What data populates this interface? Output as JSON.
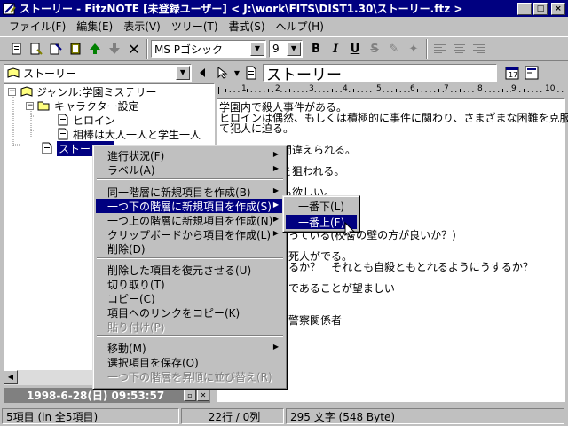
{
  "window": {
    "title": "ストーリー - FitzNOTE [未登録ユーザー] < J:\\work\\FITS\\DIST1.30\\ストーリー.ftz >",
    "minimize": "_",
    "maximize": "□",
    "close": "×"
  },
  "menubar": {
    "items": [
      {
        "label": "ファイル(F)"
      },
      {
        "label": "編集(E)"
      },
      {
        "label": "表示(V)"
      },
      {
        "label": "ツリー(T)"
      },
      {
        "label": "書式(S)"
      },
      {
        "label": "ヘルプ(H)"
      }
    ]
  },
  "toolbar": {
    "font_name": "MS Pゴシック",
    "font_size": "9",
    "bold": "B",
    "italic": "I",
    "underline": "U",
    "strike": "S",
    "delete": "✕"
  },
  "row2": {
    "node_combo_value": "ストーリー",
    "title_field_value": "ストーリー"
  },
  "tree": {
    "nodes": [
      {
        "label": "ジャンル:学園ミステリー"
      },
      {
        "label": "キャラクター設定"
      },
      {
        "label": "ヒロイン"
      },
      {
        "label": "相棒は大人一人と学生一人"
      },
      {
        "label": "ストーリー"
      }
    ],
    "expand_minus": "−"
  },
  "date_panel": {
    "text": "1998-6-28(日) 09:53:57"
  },
  "ruler": {
    "marks": [
      "1",
      "2",
      "3",
      "4",
      "5",
      "6",
      "7",
      "8",
      "9",
      "10"
    ]
  },
  "editor": {
    "lines": [
      "学園内で殺人事件がある。",
      "ヒロインは偶然、もしくは積極的に事件に関わり、さまざまな困難を克服し",
      "て犯人に迫る。",
      "",
      "…と間違えられる。",
      "",
      "に命を狙われる。",
      "",
      "要素も欲しい。",
      "",
      "いる。",
      "目になってい",
      "下がっている(校舎の壁の方が良いか？)",
      "",
      "二の死人がでる。",
      "にするか？　それとも自殺ともとれるようにうするか？",
      "",
      "人物であることが望ましい",
      "",
      "師",
      "来た警察関係者"
    ]
  },
  "statusbar": {
    "items": "5項目 (in 全5項目)",
    "position": "22行 / 0列",
    "chars": "295 文字 (548 Byte)"
  },
  "context_menu": {
    "items": [
      {
        "label": "進行状況(F)",
        "submenu": true
      },
      {
        "label": "ラベル(A)",
        "submenu": true
      },
      {
        "label": "同一階層に新規項目を作成(B)",
        "submenu": true
      },
      {
        "label": "一つ下の階層に新規項目を作成(S)",
        "submenu": true
      },
      {
        "label": "一つ上の階層に新規項目を作成(N)",
        "submenu": true
      },
      {
        "label": "クリップボードから項目を作成(L)",
        "submenu": true
      },
      {
        "label": "削除(D)"
      },
      {
        "label": "削除した項目を復元させる(U)"
      },
      {
        "label": "切り取り(T)"
      },
      {
        "label": "コピー(C)"
      },
      {
        "label": "項目へのリンクをコピー(K)"
      },
      {
        "label": "貼り付け(P)"
      },
      {
        "label": "移動(M)",
        "submenu": true
      },
      {
        "label": "選択項目を保存(O)"
      },
      {
        "label": "一つ下の階層を昇順に並び替え(R)"
      }
    ],
    "submenu_arrow": "▶"
  },
  "sub_menu": {
    "items": [
      {
        "label": "一番下(L)"
      },
      {
        "label": "一番上(F)"
      }
    ]
  },
  "colors": {
    "selection": "#000080",
    "face": "#c0c0c0"
  }
}
